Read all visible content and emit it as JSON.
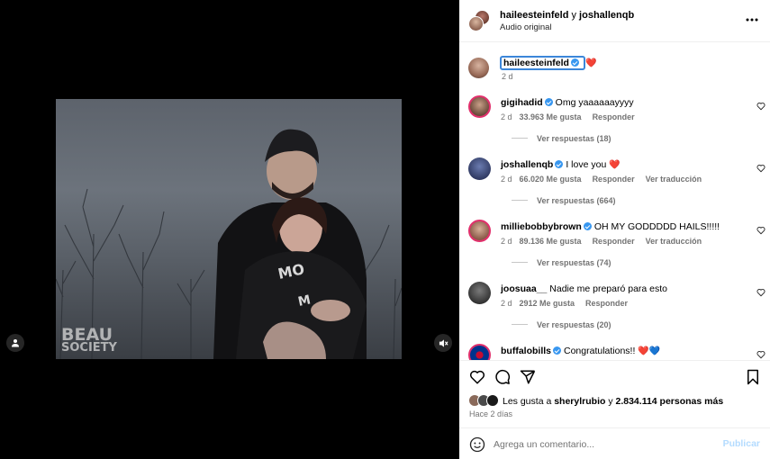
{
  "post": {
    "watermark_line1": "BEAU",
    "watermark_line2": "SOCIETY"
  },
  "header": {
    "author1": "haileesteinfeld",
    "conjunction": " y ",
    "author2": "joshallenqb",
    "subtitle": "Audio original"
  },
  "caption": {
    "username": "haileesteinfeld",
    "emoji": "❤️",
    "time": "2 d"
  },
  "comments": [
    {
      "username": "gigihadid",
      "verified": true,
      "text": "Omg yaaaaaayyyy",
      "time": "2 d",
      "likes": "33.963 Me gusta",
      "reply": "Responder",
      "translate": "",
      "replies": "Ver respuestas (18)",
      "avatar_color": "#6b4a3a"
    },
    {
      "username": "joshallenqb",
      "verified": true,
      "text": "I love you",
      "emoji": "❤️",
      "time": "2 d",
      "likes": "66.020 Me gusta",
      "reply": "Responder",
      "translate": "Ver traducción",
      "replies": "Ver respuestas (664)",
      "avatar_color": "#3a4a7a"
    },
    {
      "username": "milliebobbybrown",
      "verified": true,
      "text": "OH MY GODDDDD HAILS!!!!!",
      "time": "2 d",
      "likes": "89.136 Me gusta",
      "reply": "Responder",
      "translate": "Ver traducción",
      "replies": "Ver respuestas (74)",
      "avatar_color": "#8a5a48"
    },
    {
      "username": "joosuaa__",
      "verified": false,
      "text": "Nadie me preparó para esto",
      "time": "2 d",
      "likes": "2912 Me gusta",
      "reply": "Responder",
      "translate": "",
      "replies": "Ver respuestas (20)",
      "avatar_color": "#3c3c3c"
    },
    {
      "username": "buffalobills",
      "verified": true,
      "text": "Congratulations!!",
      "emoji": "❤️",
      "emoji2": "💙",
      "avatar_color": "#00338d"
    }
  ],
  "likes": {
    "prefix": "Les gusta a ",
    "user": "sherylrubio",
    "middle": " y ",
    "count": "2.834.114 personas más"
  },
  "posted_time": "Hace 2 días",
  "add_comment": {
    "placeholder": "Agrega un comentario...",
    "post_label": "Publicar"
  }
}
